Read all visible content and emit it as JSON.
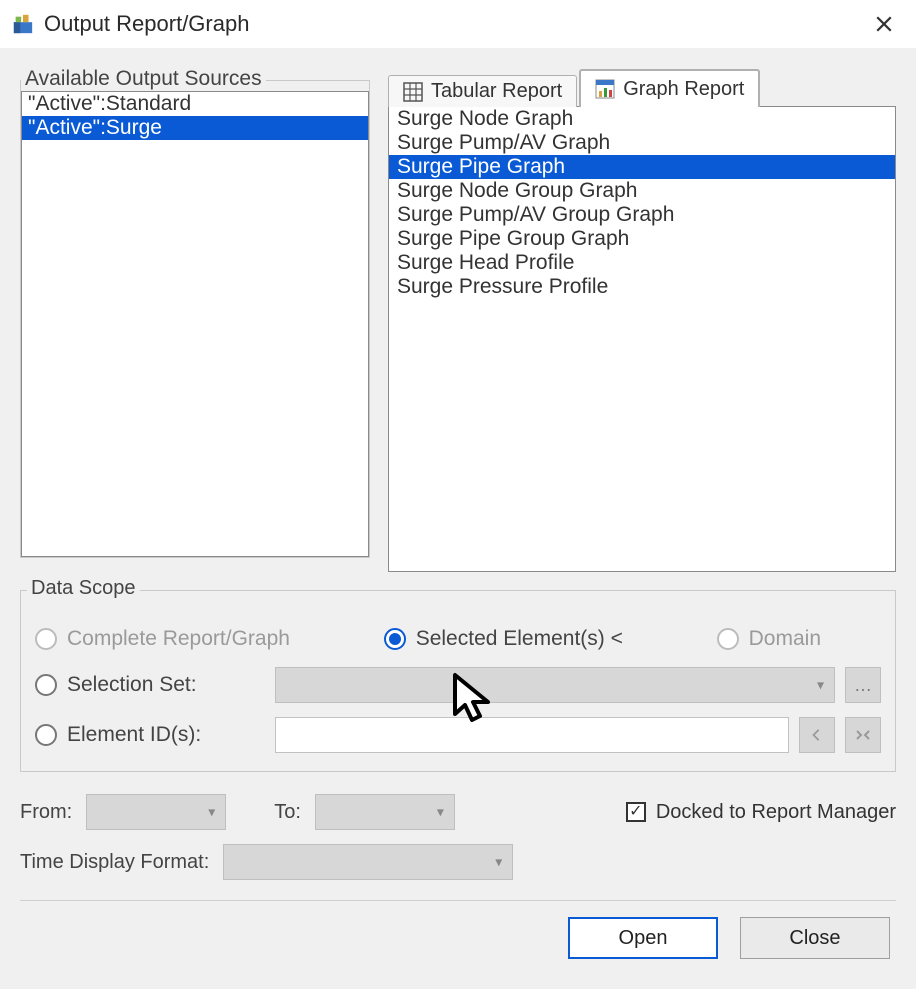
{
  "window": {
    "title": "Output Report/Graph"
  },
  "sources": {
    "legend": "Available Output Sources",
    "items": [
      {
        "label": "\"Active\":Standard",
        "selected": false
      },
      {
        "label": "\"Active\":Surge",
        "selected": true
      }
    ]
  },
  "tabs": {
    "tabular": "Tabular Report",
    "graph": "Graph Report",
    "active": "graph"
  },
  "reports": {
    "items": [
      {
        "label": "Surge Node Graph",
        "selected": false
      },
      {
        "label": "Surge Pump/AV Graph",
        "selected": false
      },
      {
        "label": "Surge Pipe Graph",
        "selected": true
      },
      {
        "label": "Surge Node Group Graph",
        "selected": false
      },
      {
        "label": "Surge Pump/AV Group Graph",
        "selected": false
      },
      {
        "label": "Surge Pipe Group Graph",
        "selected": false
      },
      {
        "label": "Surge Head Profile",
        "selected": false
      },
      {
        "label": "Surge Pressure Profile",
        "selected": false
      }
    ]
  },
  "scope": {
    "legend": "Data Scope",
    "complete_label": "Complete Report/Graph",
    "selected_label": "Selected Element(s) <",
    "domain_label": "Domain",
    "selection_set_label": "Selection Set:",
    "element_ids_label": "Element ID(s):",
    "selected_option": "selected_elements"
  },
  "time": {
    "from_label": "From:",
    "to_label": "To:",
    "format_label": "Time Display Format:",
    "from_value": "",
    "to_value": "",
    "format_value": ""
  },
  "docked": {
    "label": "Docked to Report Manager",
    "checked": true
  },
  "buttons": {
    "open": "Open",
    "close": "Close"
  }
}
